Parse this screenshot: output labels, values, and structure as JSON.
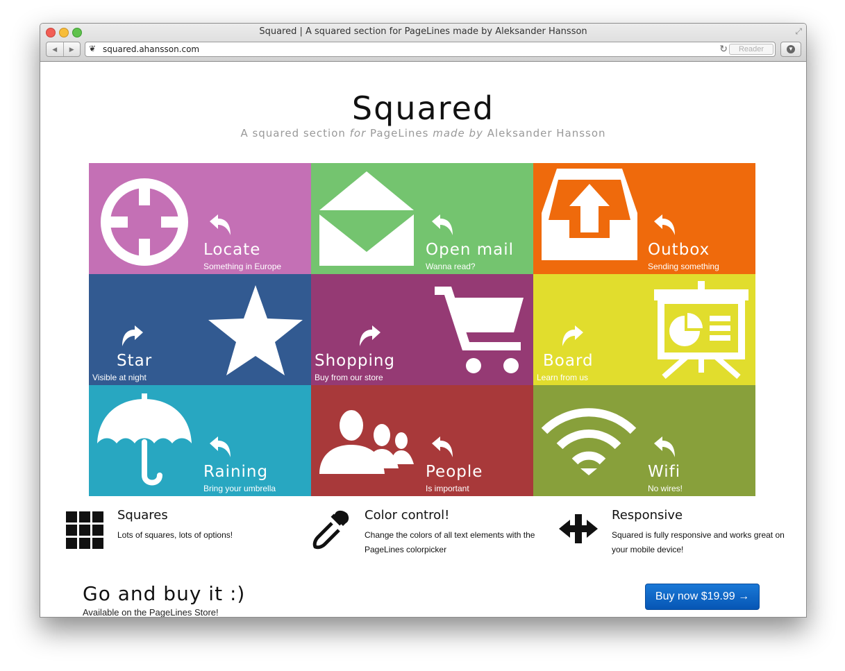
{
  "browser": {
    "window_title": "Squared | A squared section for PageLines made by Aleksander Hansson",
    "url": "squared.ahansson.com",
    "reader_label": "Reader"
  },
  "page": {
    "title": "Squared",
    "subtitle": {
      "part1": "A squared section ",
      "for": "for",
      "part2": " PageLines ",
      "made_by": "made by",
      "part3": " Aleksander Hansson"
    }
  },
  "tiles": [
    {
      "name": "Locate",
      "sub": "Something in Europe",
      "color": "#c470b5",
      "icon": "crosshair-icon"
    },
    {
      "name": "Open mail",
      "sub": "Wanna read?",
      "color": "#74c46f",
      "icon": "open-mail-icon"
    },
    {
      "name": "Outbox",
      "sub": "Sending something",
      "color": "#ef6a0c",
      "icon": "outbox-icon"
    },
    {
      "name": "Star",
      "sub": "Visible at night",
      "color": "#325a91",
      "icon": "star-icon"
    },
    {
      "name": "Shopping",
      "sub": "Buy from our store",
      "color": "#953a74",
      "icon": "cart-icon"
    },
    {
      "name": "Board",
      "sub": "Learn from us",
      "color": "#e1dd2d",
      "icon": "presentation-board-icon"
    },
    {
      "name": "Raining",
      "sub": "Bring your umbrella",
      "color": "#28a7c1",
      "icon": "umbrella-icon"
    },
    {
      "name": "People",
      "sub": "Is important",
      "color": "#a8393a",
      "icon": "people-icon"
    },
    {
      "name": "Wifi",
      "sub": "No wires!",
      "color": "#88a03b",
      "icon": "wifi-icon"
    }
  ],
  "features": [
    {
      "title": "Squares",
      "text": "Lots of squares, lots of options!",
      "icon": "grid-icon"
    },
    {
      "title": "Color control!",
      "text": "Change the colors of all text elements with the PageLines colorpicker",
      "icon": "eyedropper-icon"
    },
    {
      "title": "Responsive",
      "text": "Squared is fully responsive and works great on your mobile device!",
      "icon": "move-arrows-icon"
    }
  ],
  "cta": {
    "title": "Go and buy it :)",
    "subtitle": "Available on the PageLines Store!",
    "button_label": "Buy now $19.99 →"
  }
}
